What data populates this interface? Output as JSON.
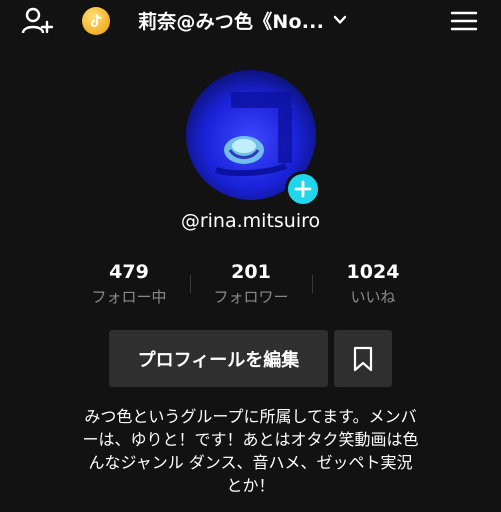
{
  "header": {
    "username": "莉奈@みつ色《No...",
    "icons": {
      "add_user": "add-user-icon",
      "coin": "tiktok-coin-icon",
      "dropdown": "chevron-down-icon",
      "menu": "hamburger-menu-icon"
    }
  },
  "profile": {
    "avatar": "avatar-blue-rose-image",
    "handle": "@rina.mitsuiro"
  },
  "stats": [
    {
      "value": "479",
      "label": "フォロー中"
    },
    {
      "value": "201",
      "label": "フォロワー"
    },
    {
      "value": "1024",
      "label": "いいね"
    }
  ],
  "actions": {
    "edit_profile": "プロフィールを編集",
    "bookmark_icon": "bookmark-icon"
  },
  "bio": {
    "lines": [
      "みつ色というグループに所属してます。メンバ",
      "ーは、ゆりと！です！あとはオタク笑動画は色",
      "んなジャンル ダンス、音ハメ、ゼッペト実況",
      "とか！"
    ]
  },
  "colors": {
    "background": "#121212",
    "accent": "#20d5ec",
    "button": "#2f2f2f",
    "muted_text": "#8a8a8a"
  }
}
